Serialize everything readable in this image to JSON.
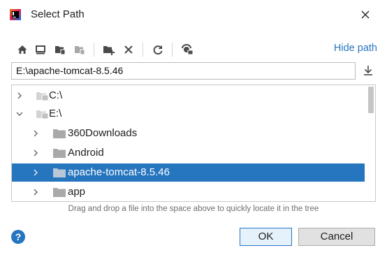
{
  "window": {
    "title": "Select Path"
  },
  "toolbar": {
    "icons": [
      "home-icon",
      "desktop-icon",
      "project-folder-icon",
      "module-folder-icon",
      "new-folder-icon",
      "delete-icon",
      "refresh-icon",
      "show-hidden-icon"
    ],
    "hide_path_label": "Hide path"
  },
  "path_field": {
    "value": "E:\\apache-tomcat-8.5.46"
  },
  "tree": {
    "items": [
      {
        "label": "C:\\",
        "icon": "drive-icon",
        "expanded": false,
        "selected": false,
        "level": 0
      },
      {
        "label": "E:\\",
        "icon": "drive-icon",
        "expanded": true,
        "selected": false,
        "level": 0
      },
      {
        "label": "360Downloads",
        "icon": "folder-icon",
        "expanded": false,
        "selected": false,
        "level": 1
      },
      {
        "label": "Android",
        "icon": "folder-icon",
        "expanded": false,
        "selected": false,
        "level": 1
      },
      {
        "label": "apache-tomcat-8.5.46",
        "icon": "folder-icon",
        "expanded": false,
        "selected": true,
        "level": 1
      },
      {
        "label": "app",
        "icon": "folder-icon",
        "expanded": false,
        "selected": false,
        "level": 1
      }
    ]
  },
  "hint": "Drag and drop a file into the space above to quickly locate it in the tree",
  "buttons": {
    "help": "?",
    "ok": "OK",
    "cancel": "Cancel"
  },
  "colors": {
    "accent": "#2675bf",
    "selection": "#2675bf"
  }
}
